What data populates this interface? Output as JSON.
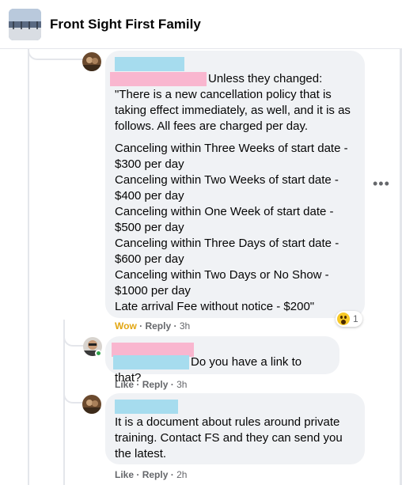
{
  "header": {
    "group_name": "Front Sight First Family"
  },
  "comment1": {
    "intro": "Unless they changed:",
    "paragraph1": "\"There is a new cancellation policy that is taking effect immediately, as well, and it is as follows. All fees are charged per day.",
    "lines": [
      "Canceling within Three Weeks of start date -",
      "$300 per day",
      "Canceling within Two Weeks of start date -",
      "$400 per day",
      "Canceling within One Week of start date -",
      "$500 per day",
      "Canceling within Three Days of start date -",
      "$600 per day",
      "Canceling within Two Days or No Show -",
      "$1000 per day",
      "Late arrival Fee without notice - $200\""
    ],
    "reaction_label": "Wow",
    "reply_label": "Reply",
    "time": "3h",
    "reaction_count": "1"
  },
  "comment2": {
    "text": "Do you have a link to that?",
    "like_label": "Like",
    "reply_label": "Reply",
    "time": "3h"
  },
  "comment3": {
    "text": "It is a document about rules around private training. Contact FS and they can send you the latest.",
    "like_label": "Like",
    "reply_label": "Reply",
    "time": "2h"
  },
  "more_icon": "more-horizontal-icon",
  "colors": {
    "bubble": "#f0f2f5",
    "redact_blue": "#a6dcee",
    "redact_pink": "#f9b6cf",
    "wow": "#e2a612"
  }
}
